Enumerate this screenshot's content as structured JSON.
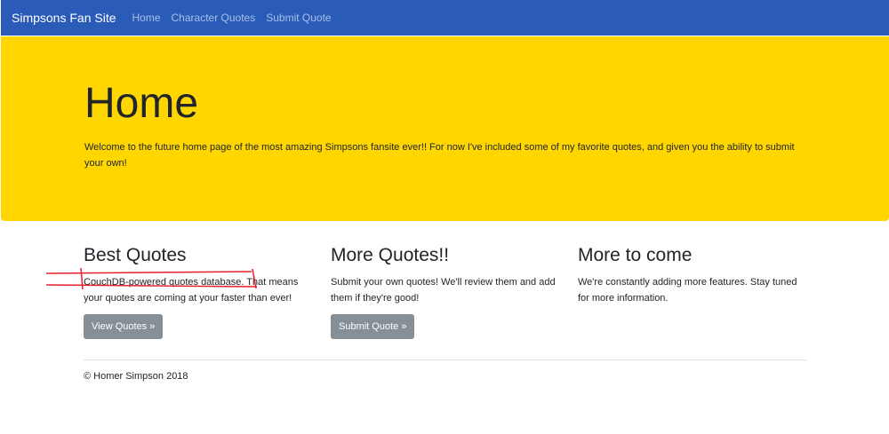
{
  "navbar": {
    "brand": "Simpsons Fan Site",
    "links": [
      "Home",
      "Character Quotes",
      "Submit Quote"
    ]
  },
  "jumbotron": {
    "title": "Home",
    "text": "Welcome to the future home page of the most amazing Simpsons fansite ever!! For now I've included some of my favorite quotes, and given you the ability to submit your own!"
  },
  "columns": [
    {
      "heading": "Best Quotes",
      "text_highlight": "CouchDB-powered quotes database.",
      "text_rest": " That means your quotes are coming at your faster than ever!",
      "button": "View Quotes »"
    },
    {
      "heading": "More Quotes!!",
      "text": "Submit your own quotes! We'll review them and add them if they're good!",
      "button": "Submit Quote »"
    },
    {
      "heading": "More to come",
      "text": "We're constantly adding more features. Stay tuned for more information."
    }
  ],
  "footer": {
    "text": "© Homer Simpson 2018"
  },
  "colors": {
    "navbar": "#2a5bb8",
    "jumbotron": "#ffd600",
    "button": "#868e96",
    "annotation": "#e8202a"
  }
}
